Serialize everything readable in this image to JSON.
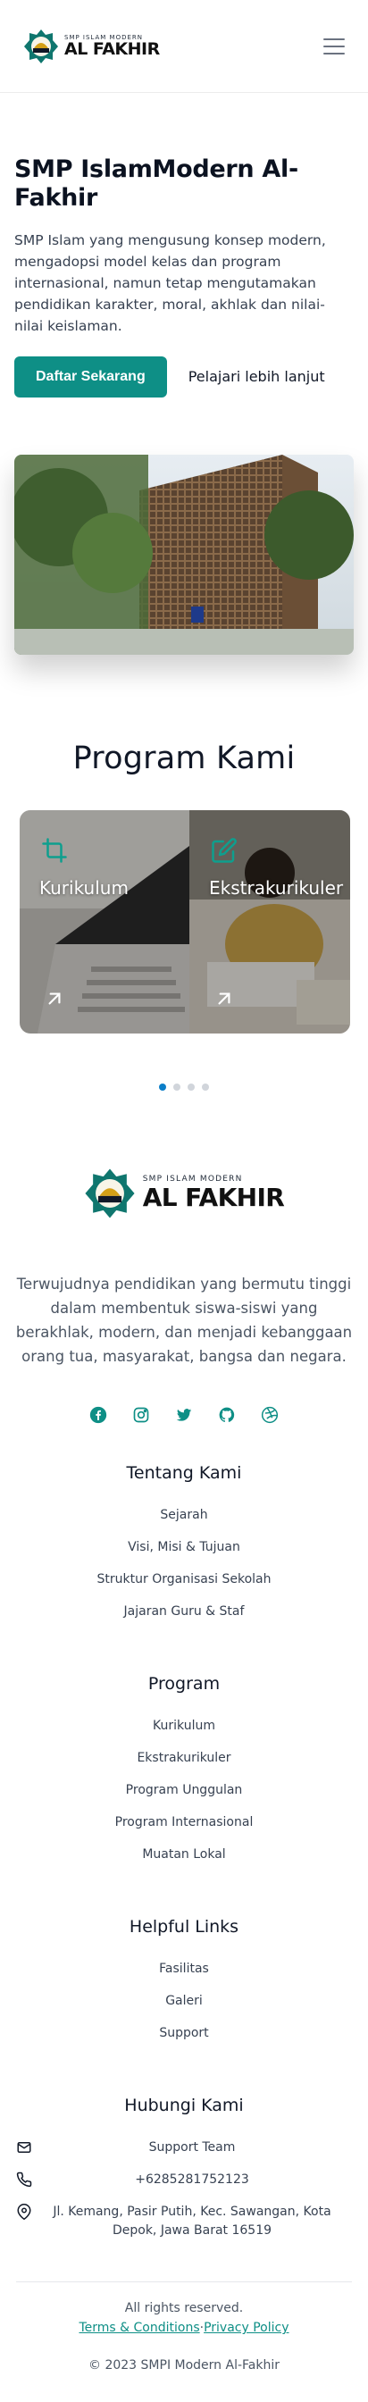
{
  "header": {
    "logo_small": "SMP ISLAM MODERN",
    "logo_big": "AL FAKHIR",
    "menu_icon": "hamburger-menu-icon"
  },
  "hero": {
    "title": "SMP IslamModern Al-Fakhir",
    "description": "SMP Islam yang mengusung konsep modern, mengadopsi model kelas dan program internasional, namun tetap mengutamakan pendidikan karakter, moral, akhlak dan nilai-nilai keislaman.",
    "primary_cta": "Daftar Sekarang",
    "secondary_cta": "Pelajari lebih lanjut"
  },
  "programs": {
    "heading": "Program Kami",
    "cards": [
      {
        "title": "Kurikulum",
        "icon": "crop-icon"
      },
      {
        "title": "Ekstrakurikuler",
        "icon": "edit-icon"
      }
    ],
    "active_slide": 1,
    "slide_count": 4
  },
  "footer": {
    "logo_small": "SMP ISLAM MODERN",
    "logo_big": "AL FAKHIR",
    "tagline": "Terwujudnya pendidikan yang bermutu tinggi dalam membentuk siswa-siswi yang berakhlak, modern, dan menjadi kebanggaan orang tua, masyarakat, bangsa dan negara.",
    "socials": [
      "facebook-icon",
      "instagram-icon",
      "twitter-icon",
      "github-icon",
      "dribbble-icon"
    ],
    "about": {
      "title": "Tentang Kami",
      "items": [
        "Sejarah",
        "Visi, Misi & Tujuan",
        "Struktur Organisasi Sekolah",
        "Jajaran Guru & Staf"
      ]
    },
    "program": {
      "title": "Program",
      "items": [
        "Kurikulum",
        "Ekstrakurikuler",
        "Program Unggulan",
        "Program Internasional",
        "Muatan Lokal"
      ]
    },
    "helpful": {
      "title": "Helpful Links",
      "items": [
        "Fasilitas",
        "Galeri",
        "Support"
      ]
    },
    "contact": {
      "title": "Hubungi Kami",
      "email": "Support Team",
      "phone": "+6285281752123",
      "address": "Jl. Kemang, Pasir Putih, Kec. Sawangan, Kota Depok, Jawa Barat 16519"
    },
    "rights": "All rights reserved.",
    "terms": "Terms & Conditions",
    "separator": "·",
    "privacy": "Privacy Policy",
    "copyright": "© 2023 SMPI Modern Al-Fakhir"
  },
  "colors": {
    "accent": "#0e8f86",
    "dot_active": "#0b7ec8"
  }
}
